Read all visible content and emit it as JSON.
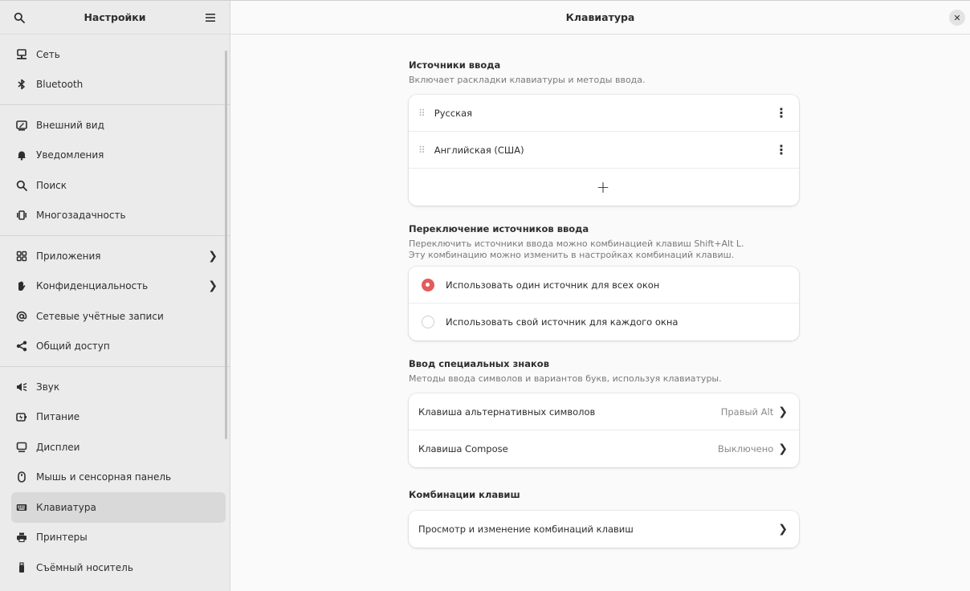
{
  "sidebar": {
    "title": "Настройки",
    "search_icon": "search-icon",
    "menu_icon": "hamburger-menu-icon",
    "groups": [
      [
        {
          "id": "network",
          "label": "Сеть",
          "icon": "network-icon"
        },
        {
          "id": "bluetooth",
          "label": "Bluetooth",
          "icon": "bluetooth-icon"
        }
      ],
      [
        {
          "id": "appearance",
          "label": "Внешний вид",
          "icon": "appearance-icon"
        },
        {
          "id": "notifications",
          "label": "Уведомления",
          "icon": "bell-icon"
        },
        {
          "id": "search",
          "label": "Поиск",
          "icon": "search-icon"
        },
        {
          "id": "multitasking",
          "label": "Многозадачность",
          "icon": "multitasking-icon"
        }
      ],
      [
        {
          "id": "apps",
          "label": "Приложения",
          "icon": "apps-grid-icon",
          "chevron": true
        },
        {
          "id": "privacy",
          "label": "Конфиденциальность",
          "icon": "hand-icon",
          "chevron": true
        },
        {
          "id": "online-accounts",
          "label": "Сетевые учётные записи",
          "icon": "at-sign-icon"
        },
        {
          "id": "sharing",
          "label": "Общий доступ",
          "icon": "share-icon"
        }
      ],
      [
        {
          "id": "sound",
          "label": "Звук",
          "icon": "speaker-icon"
        },
        {
          "id": "power",
          "label": "Питание",
          "icon": "power-icon"
        },
        {
          "id": "displays",
          "label": "Дисплеи",
          "icon": "display-icon"
        },
        {
          "id": "mouse",
          "label": "Мышь и сенсорная панель",
          "icon": "mouse-icon"
        },
        {
          "id": "keyboard",
          "label": "Клавиатура",
          "icon": "keyboard-icon",
          "active": true
        },
        {
          "id": "printers",
          "label": "Принтеры",
          "icon": "printer-icon"
        },
        {
          "id": "removable",
          "label": "Съёмный носитель",
          "icon": "usb-icon"
        }
      ]
    ]
  },
  "main": {
    "title": "Клавиатура",
    "input_sources": {
      "title": "Источники ввода",
      "description": "Включает раскладки клавиатуры и методы ввода.",
      "items": [
        "Русская",
        "Английская (США)"
      ],
      "add_label": "+"
    },
    "switching": {
      "title": "Переключение источников ввода",
      "description_line1": "Переключить источники ввода можно комбинацией клавиш Shift+Alt L.",
      "description_line2": "Эту комбинацию можно изменить в настройках комбинаций клавиш.",
      "options": [
        {
          "label": "Использовать один источник для всех окон",
          "checked": true
        },
        {
          "label": "Использовать свой источник для каждого окна",
          "checked": false
        }
      ]
    },
    "special": {
      "title": "Ввод специальных знаков",
      "description": "Методы ввода символов и вариантов букв, используя клавиатуры.",
      "rows": [
        {
          "label": "Клавиша альтернативных символов",
          "value": "Правый Alt"
        },
        {
          "label": "Клавиша Compose",
          "value": "Выключено"
        }
      ]
    },
    "shortcuts": {
      "title": "Комбинации клавиш",
      "row_label": "Просмотр и изменение комбинаций клавиш"
    }
  },
  "colors": {
    "accent": "#e45b5b",
    "sidebar_bg": "#ebebeb",
    "content_bg": "#fafafa"
  }
}
